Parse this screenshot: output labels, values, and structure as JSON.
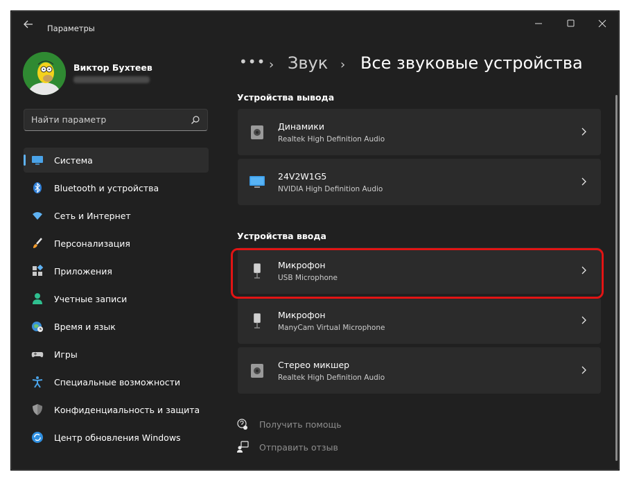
{
  "app": {
    "title": "Параметры"
  },
  "user": {
    "name": "Виктор Бухтеев"
  },
  "search": {
    "placeholder": "Найти параметр"
  },
  "sidebar": {
    "items": [
      {
        "label": "Система",
        "icon": "monitor-icon",
        "selected": true
      },
      {
        "label": "Bluetooth и устройства",
        "icon": "bluetooth-icon"
      },
      {
        "label": "Сеть и Интернет",
        "icon": "wifi-icon"
      },
      {
        "label": "Персонализация",
        "icon": "brush-icon"
      },
      {
        "label": "Приложения",
        "icon": "apps-icon"
      },
      {
        "label": "Учетные записи",
        "icon": "person-icon"
      },
      {
        "label": "Время и язык",
        "icon": "globe-clock-icon"
      },
      {
        "label": "Игры",
        "icon": "gamepad-icon"
      },
      {
        "label": "Специальные возможности",
        "icon": "accessibility-icon"
      },
      {
        "label": "Конфиденциальность и защита",
        "icon": "shield-icon"
      },
      {
        "label": "Центр обновления Windows",
        "icon": "update-icon"
      }
    ]
  },
  "breadcrumb": {
    "more": "•••",
    "sep": "›",
    "parent": "Звук",
    "current": "Все звуковые устройства"
  },
  "output": {
    "heading": "Устройства вывода",
    "devices": [
      {
        "name": "Динамики",
        "sub": "Realtek High Definition Audio",
        "icon": "speaker-icon"
      },
      {
        "name": "24V2W1G5",
        "sub": "NVIDIA High Definition Audio",
        "icon": "monitor-icon"
      }
    ]
  },
  "input": {
    "heading": "Устройства ввода",
    "devices": [
      {
        "name": "Микрофон",
        "sub": "USB Microphone",
        "icon": "microphone-icon",
        "highlighted": true
      },
      {
        "name": "Микрофон",
        "sub": "ManyCam Virtual Microphone",
        "icon": "microphone-icon"
      },
      {
        "name": "Стерео микшер",
        "sub": "Realtek High Definition Audio",
        "icon": "speaker-icon"
      }
    ]
  },
  "links": {
    "help": "Получить помощь",
    "feedback": "Отправить отзыв"
  },
  "colors": {
    "accent": "#5fb2f2",
    "highlight": "#e21414",
    "background": "#202020",
    "card": "#2b2b2b"
  }
}
